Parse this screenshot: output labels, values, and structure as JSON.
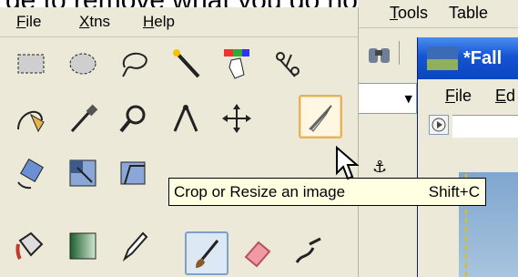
{
  "caption": {
    "text": "ge to remove what you do not need"
  },
  "toolbox": {
    "menu": [
      {
        "prefix": "",
        "mnemonic": "F",
        "rest": "ile"
      },
      {
        "prefix": "",
        "mnemonic": "X",
        "rest": "tns"
      },
      {
        "prefix": "",
        "mnemonic": "H",
        "rest": "elp"
      }
    ],
    "tools": [
      "rect-select",
      "ellipse-select",
      "free-select",
      "fuzzy-select",
      "color-select",
      "scissors",
      "paths",
      "color-picker",
      "zoom",
      "measure",
      "move",
      "crop",
      "rotate",
      "scale",
      "shear",
      "perspective",
      "flip",
      "text",
      "bucket-fill",
      "blend",
      "pencil",
      "paintbrush",
      "eraser",
      "airbrush"
    ],
    "active_tool": "crop"
  },
  "background_app": {
    "menu": [
      {
        "mnemonic": "T",
        "rest": "ools"
      },
      {
        "mnemonic": "",
        "rest": "Table"
      }
    ],
    "window_title": "*Fall",
    "window_menu": [
      {
        "mnemonic": "F",
        "rest": "ile"
      },
      {
        "mnemonic": "E",
        "rest": "d"
      }
    ]
  },
  "tooltip": {
    "text": "Crop or Resize an image",
    "shortcut": "Shift+C"
  },
  "colors": {
    "panel_bg": "#ece9d8",
    "titlebar_blue": "#0a46c2",
    "tooltip_bg": "#ffffe1",
    "active_border": "#e7b35a"
  }
}
